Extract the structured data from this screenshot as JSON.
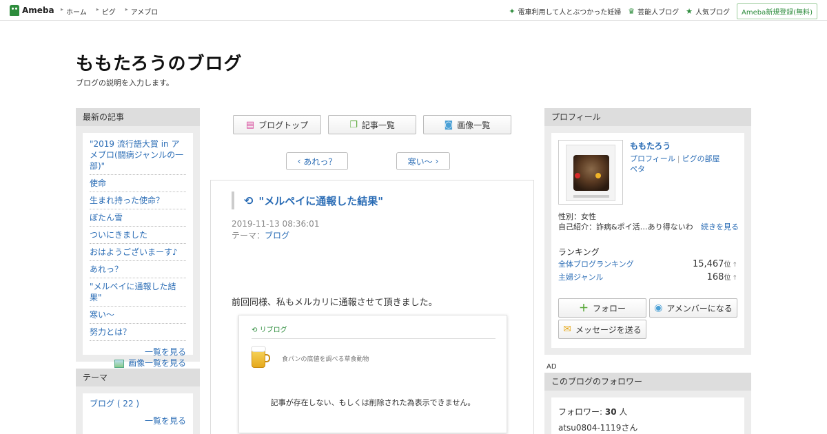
{
  "topbar": {
    "logo_text": "Ameba",
    "nav": [
      "ホーム",
      "ピグ",
      "アメブロ"
    ],
    "right_links": [
      {
        "icon": "star-burst-icon",
        "glyph": "✦",
        "label": "電車利用して人とぶつかった妊婦"
      },
      {
        "icon": "crown-icon",
        "glyph": "♛",
        "label": "芸能人ブログ"
      },
      {
        "icon": "star-icon",
        "glyph": "★",
        "label": "人気ブログ"
      }
    ],
    "signup": "Ameba新規登録(無料)"
  },
  "header": {
    "title": "ももたろうのブログ",
    "description": "ブログの説明を入力します。"
  },
  "recent": {
    "heading": "最新の記事",
    "items": [
      "\"2019 流行語大賞 in アメブロ(闘病ジャンルの一部)\"",
      "使命",
      "生まれ持った使命？",
      "ぼたん雪",
      "ついにきました",
      "おはようございまーす♪",
      "あれっ？",
      "\"メルペイに通報した結果\"",
      "寒い～",
      "努力とは？"
    ],
    "see_list": "一覧を見る",
    "see_images": "画像一覧を見る"
  },
  "theme": {
    "heading": "テーマ",
    "items": [
      "ブログ ( 22 )"
    ],
    "see_list": "一覧を見る"
  },
  "center": {
    "nav_buttons": [
      "ブログトップ",
      "記事一覧",
      "画像一覧"
    ],
    "prev": "あれっ？",
    "next": "寒い～",
    "article": {
      "title": "\"メルペイに通報した結果\"",
      "date": "2019-11-13 08:36:01",
      "theme_label": "テーマ：",
      "theme": "ブログ",
      "body": "前回同様、私もメルカリに通報させて頂きました。",
      "reblog": {
        "label": "リブログ",
        "source": "食パンの底値を調べる草食動物",
        "message": "記事が存在しない、もしくは削除された為表示できません。"
      }
    }
  },
  "profile": {
    "heading": "プロフィール",
    "name": "ももたろう",
    "link_profile": "プロフィール",
    "link_pig": "ピグの部屋",
    "link_peta": "ペタ",
    "gender": "性別：女性",
    "intro": "自己紹介：詐病&ポイ活…あり得ないわ",
    "more": "続きを見る",
    "ranking_title": "ランキング",
    "rankings": [
      {
        "label": "全体ブログランキング",
        "value": "15,467",
        "unit": "位",
        "arrow": "↑"
      },
      {
        "label": "主婦ジャンル",
        "value": "168",
        "unit": "位",
        "arrow": "↑"
      }
    ],
    "follow": "フォロー",
    "member": "アメンバーになる",
    "message": "メッセージを送る"
  },
  "ad_label": "AD",
  "followers": {
    "heading": "このブログのフォロワー",
    "count_label": "フォロワー:",
    "count": "30",
    "count_unit": "人",
    "first": "atsu0804-1119さん"
  },
  "colors": {
    "link": "#2a6cb5",
    "ameba_green": "#2d8c3c"
  }
}
